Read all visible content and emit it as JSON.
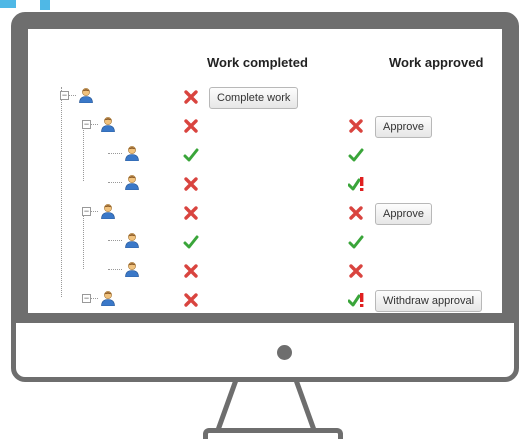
{
  "headers": {
    "work_completed": "Work completed",
    "work_approved": "Work approved"
  },
  "rows": [
    {
      "level": 0,
      "completed": "cross",
      "approved": "none",
      "completed_button": "Complete work",
      "approved_button": ""
    },
    {
      "level": 1,
      "completed": "cross",
      "approved": "cross",
      "completed_button": "",
      "approved_button": "Approve"
    },
    {
      "level": 2,
      "completed": "check",
      "approved": "check",
      "completed_button": "",
      "approved_button": ""
    },
    {
      "level": 2,
      "completed": "cross",
      "approved": "check-warning",
      "completed_button": "",
      "approved_button": ""
    },
    {
      "level": 1,
      "completed": "cross",
      "approved": "cross",
      "completed_button": "",
      "approved_button": "Approve"
    },
    {
      "level": 2,
      "completed": "check",
      "approved": "check",
      "completed_button": "",
      "approved_button": ""
    },
    {
      "level": 2,
      "completed": "cross",
      "approved": "cross",
      "completed_button": "",
      "approved_button": ""
    },
    {
      "level": 1,
      "completed": "cross",
      "approved": "check-warning",
      "completed_button": "",
      "approved_button": "Withdraw approval"
    }
  ],
  "colors": {
    "monitor_frame": "#6e6e6e",
    "accent": "#4fb8e6",
    "cross": "#d9443f",
    "check": "#3aa53a",
    "warning": "#e02020"
  },
  "icons": {
    "user": "user-icon",
    "cross": "cross-icon",
    "check": "check-icon",
    "warning": "warning-icon"
  }
}
